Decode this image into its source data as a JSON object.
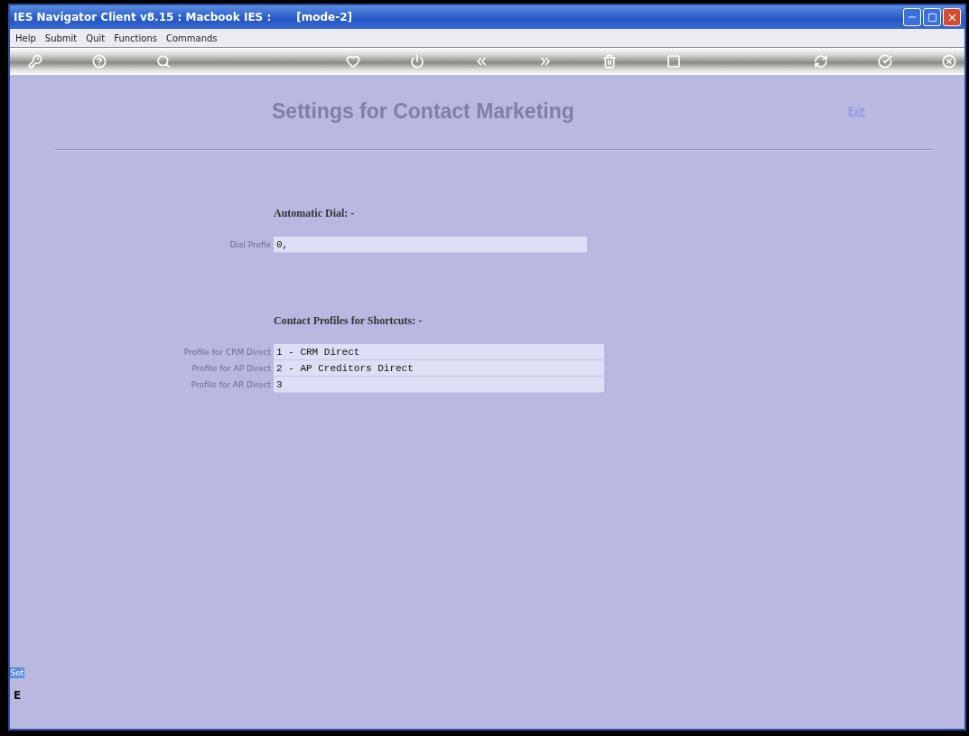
{
  "window": {
    "title": "IES Navigator Client v8.15 : Macbook IES :",
    "mode": "[mode-2]"
  },
  "menu": [
    "Help",
    "Submit",
    "Quit",
    "Functions",
    "Commands"
  ],
  "page": {
    "title": "Settings for Contact Marketing",
    "link": "Exit"
  },
  "sections": [
    {
      "heading": "Automatic Dial: -",
      "fields": [
        {
          "label": "Dial Prefix",
          "value": "0,"
        }
      ]
    },
    {
      "heading": "Contact Profiles for Shortcuts: -",
      "fields": [
        {
          "label": "Profile for CRM Direct",
          "value": "1 - CRM Direct"
        },
        {
          "label": "Profile for AP Direct",
          "value": "2 - AP Creditors Direct"
        },
        {
          "label": "Profile for AR Direct",
          "value": "3"
        }
      ]
    }
  ],
  "side_tab": {
    "label": "Set",
    "letter": "E"
  }
}
